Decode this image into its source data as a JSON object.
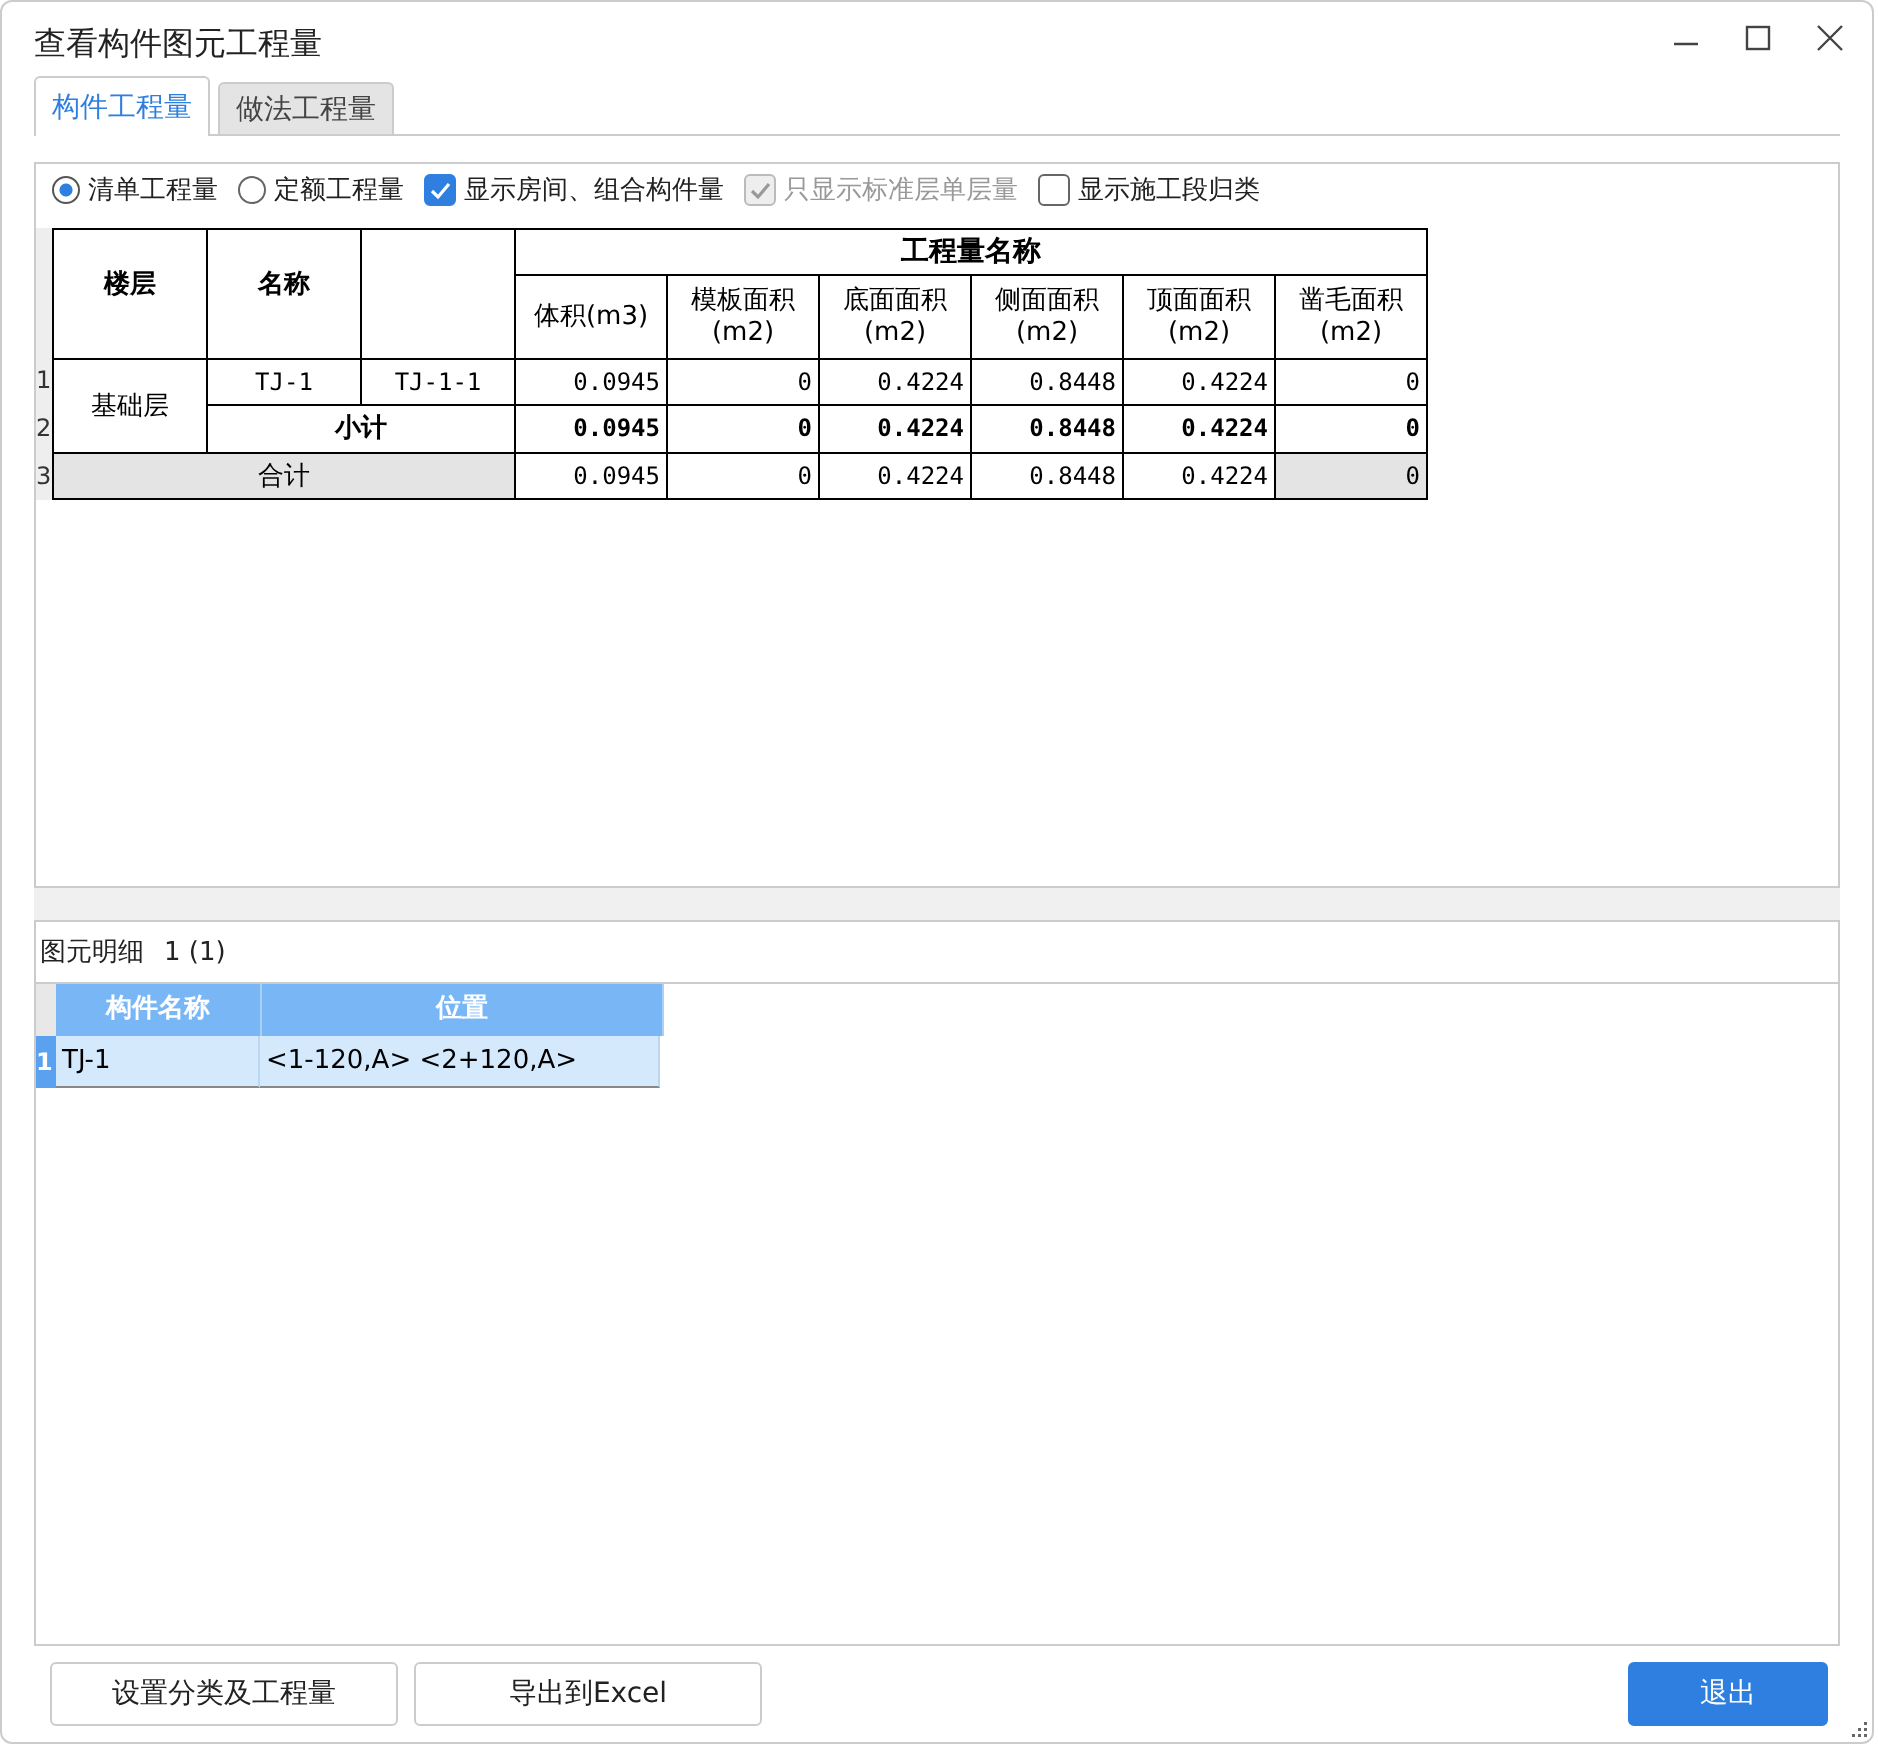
{
  "window": {
    "title": "查看构件图元工程量"
  },
  "tabs": [
    {
      "label": "构件工程量",
      "selected": true
    },
    {
      "label": "做法工程量",
      "selected": false
    }
  ],
  "options": [
    {
      "kind": "radio",
      "label": "清单工程量",
      "selected": true
    },
    {
      "kind": "radio",
      "label": "定额工程量",
      "selected": false
    },
    {
      "kind": "checkbox",
      "label": "显示房间、组合构件量",
      "checked": true,
      "disabled": false
    },
    {
      "kind": "checkbox",
      "label": "只显示标准层单层量",
      "checked": true,
      "disabled": true
    },
    {
      "kind": "checkbox",
      "label": "显示施工段归类",
      "checked": false,
      "disabled": false
    }
  ],
  "quantity_table": {
    "columns": {
      "floor": "楼层",
      "name": "名称",
      "group": "工程量名称",
      "quantities": [
        "体积(m3)",
        "模板面积(m2)",
        "底面面积(m2)",
        "侧面面积(m2)",
        "顶面面积(m2)",
        "凿毛面积(m2)"
      ]
    },
    "rows": [
      {
        "row_number": "1",
        "kind": "item",
        "floor": "基础层",
        "name": "TJ-1",
        "name_2": "TJ-1-1",
        "values": [
          "0.0945",
          "0",
          "0.4224",
          "0.8448",
          "0.4224",
          "0"
        ]
      },
      {
        "row_number": "2",
        "kind": "subtotal",
        "label": "小计",
        "values": [
          "0.0945",
          "0",
          "0.4224",
          "0.8448",
          "0.4224",
          "0"
        ]
      },
      {
        "row_number": "3",
        "kind": "total",
        "label": "合计",
        "values": [
          "0.0945",
          "0",
          "0.4224",
          "0.8448",
          "0.4224",
          "0"
        ]
      }
    ]
  },
  "detail": {
    "title": "图元明细",
    "count": "1 (1)",
    "columns": [
      "构件名称",
      "位置"
    ],
    "rows": [
      {
        "row_number": "1",
        "selected": true,
        "cells": [
          "TJ-1",
          "<1-120,A> <2+120,A>"
        ]
      }
    ]
  },
  "buttons": [
    {
      "label": "设置分类及工程量",
      "kind": "default"
    },
    {
      "label": "导出到Excel",
      "kind": "default"
    },
    {
      "label": "退出",
      "kind": "primary"
    }
  ]
}
